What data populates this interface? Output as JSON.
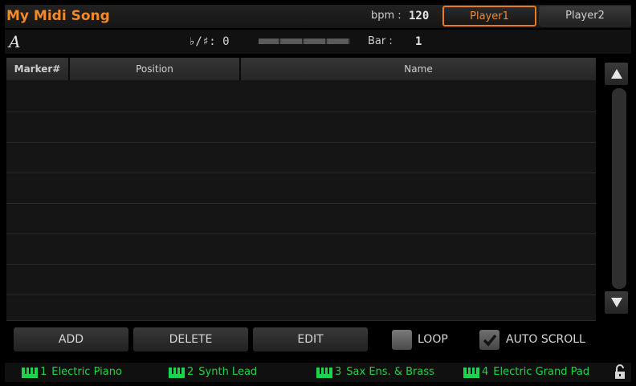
{
  "header": {
    "song_title": "My Midi Song",
    "bpm_label": "bpm :",
    "bpm_value": "120",
    "player1_label": "Player1",
    "player2_label": "Player2"
  },
  "info": {
    "chord": "A",
    "key_label": "♭/♯:",
    "key_value": "0",
    "meter_segments": 4,
    "bar_label": "Bar :",
    "bar_value": "1"
  },
  "table": {
    "columns": [
      "Marker#",
      "Position",
      "Name"
    ],
    "rows": []
  },
  "buttons": {
    "add": "ADD",
    "delete": "DELETE",
    "edit": "EDIT"
  },
  "options": {
    "loop_label": "LOOP",
    "loop_checked": false,
    "auto_scroll_label": "AUTO SCROLL",
    "auto_scroll_checked": true
  },
  "tracks": [
    {
      "num": "1",
      "name": "Electric Piano"
    },
    {
      "num": "2",
      "name": "Synth Lead"
    },
    {
      "num": "3",
      "name": "Sax Ens. & Brass"
    },
    {
      "num": "4",
      "name": "Electric Grand Pad"
    }
  ],
  "colors": {
    "accent_orange": "#f08a2b",
    "track_green": "#1fd34a"
  }
}
